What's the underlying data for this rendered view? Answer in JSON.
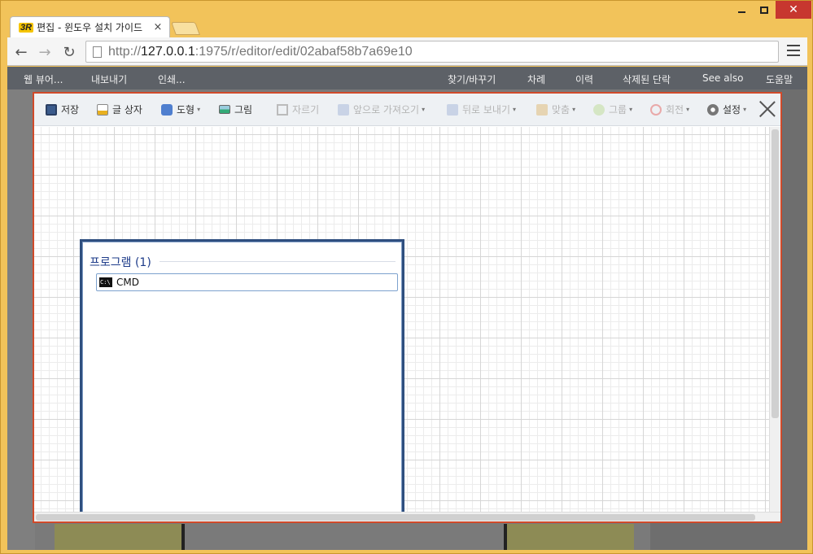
{
  "window": {
    "controls": {
      "minimize_icon": "minimize-icon",
      "maximize_icon": "maximize-icon",
      "close_icon": "close-icon"
    }
  },
  "tabs": [
    {
      "logo": "3R",
      "title": "편집 - 윈도우 설치 가이드",
      "close": "×"
    }
  ],
  "toolbar": {
    "url_scheme": "http://",
    "url_host": "127.0.0.1",
    "url_rest": ":1975/r/editor/edit/02abaf58b7a69e10"
  },
  "page_menu": {
    "left": [
      "웹 뷰어...",
      "내보내기",
      "인쇄..."
    ],
    "right": [
      "찾기/바꾸기",
      "차례",
      "이력",
      "삭제된 단락",
      "See also",
      "도움말"
    ]
  },
  "editor_toolbar": {
    "save": "저장",
    "textbox": "글 상자",
    "shape": "도형",
    "image": "그림",
    "crop": "자르기",
    "bring_front": "앞으로 가져오기",
    "send_back": "뒤로 보내기",
    "align": "맞춤",
    "group": "그룹",
    "rotate": "회전",
    "settings": "설정"
  },
  "panel": {
    "heading": "프로그램 (1)",
    "item_icon_text": "C:\\",
    "item": "CMD"
  },
  "colors": {
    "frame": "#f2c35a",
    "editor_border": "#d04a2a",
    "menubar": "#5d6167",
    "panel_border": "#2f4f7f"
  }
}
